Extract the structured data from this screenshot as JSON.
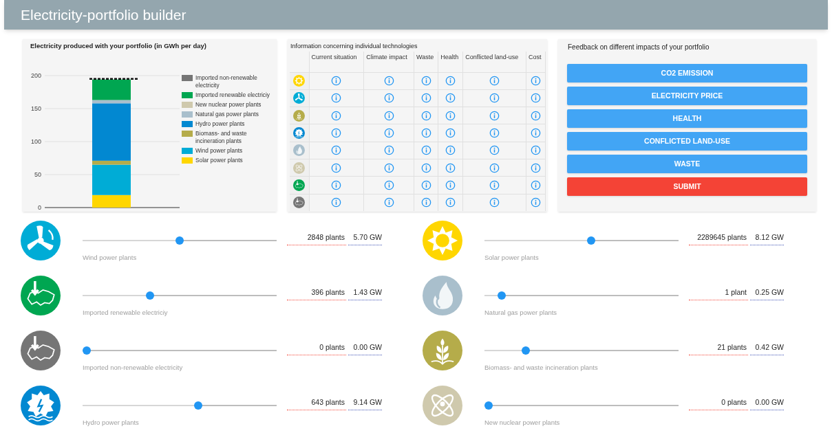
{
  "header": {
    "title": "Electricity-portfolio builder"
  },
  "production_panel": {
    "chart_data": {
      "type": "bar",
      "title": "Electricity produced with your portfolio (in GWh per day)",
      "stacked": true,
      "ylim": [
        0,
        200
      ],
      "yticks": [
        0,
        50,
        100,
        150,
        200
      ],
      "grid": true,
      "ref_lines": [
        {
          "axis": "y",
          "value": 195
        }
      ],
      "series": [
        {
          "name": "Solar power plants",
          "color": "#ffd600",
          "values": [
            19
          ]
        },
        {
          "name": "Wind power plants",
          "color": "#00acd6",
          "values": [
            46
          ]
        },
        {
          "name": "Biomass- and waste incineration plants",
          "color": "#b5ac4a",
          "values": [
            6
          ]
        },
        {
          "name": "Hydro power plants",
          "color": "#0288d1",
          "values": [
            87
          ]
        },
        {
          "name": "Natural gas power plants",
          "color": "#a9bfcc",
          "values": [
            5
          ]
        },
        {
          "name": "New nuclear power plants",
          "color": "#cfc9ad",
          "values": [
            0
          ]
        },
        {
          "name": "Imported renewable electriciy",
          "color": "#00a651",
          "values": [
            31
          ]
        },
        {
          "name": "Imported non-renewable electricity",
          "color": "#757575",
          "values": [
            0
          ]
        }
      ]
    }
  },
  "info_panel": {
    "title": "Information concerning individual technologies",
    "columns": [
      "Current situation",
      "Climate impact",
      "Waste",
      "Health",
      "Conflicted land-use",
      "Cost"
    ],
    "rows": [
      {
        "kind": "solar",
        "color": "#ffd600"
      },
      {
        "kind": "wind",
        "color": "#00acd6"
      },
      {
        "kind": "biomass",
        "color": "#b5ac4a"
      },
      {
        "kind": "hydro",
        "color": "#0288d1"
      },
      {
        "kind": "gas",
        "color": "#a9bfcc"
      },
      {
        "kind": "nuclear",
        "color": "#cfc9ad"
      },
      {
        "kind": "import",
        "color": "#00a651"
      },
      {
        "kind": "import",
        "color": "#757575"
      }
    ]
  },
  "feedback_panel": {
    "title": "Feedback on different impacts of your portfolio",
    "buttons": [
      {
        "label": "CO2 EMISSION",
        "kind": "info"
      },
      {
        "label": "ELECTRICITY PRICE",
        "kind": "info"
      },
      {
        "label": "HEALTH",
        "kind": "info"
      },
      {
        "label": "CONFLICTED LAND-USE",
        "kind": "info"
      },
      {
        "label": "WASTE",
        "kind": "info"
      },
      {
        "label": "SUBMIT",
        "kind": "submit"
      }
    ]
  },
  "sliders": [
    {
      "kind": "wind",
      "color": "#00acd6",
      "label": "Wind power plants",
      "level": 0.5,
      "plants": "2848 plants",
      "power": "5.70 GW"
    },
    {
      "kind": "solar",
      "color": "#ffd600",
      "label": "Solar power plants",
      "level": 0.55,
      "plants": "2289645 plants",
      "power": "8.12 GW"
    },
    {
      "kind": "import",
      "color": "#00a651",
      "label": "Imported renewable electriciy",
      "level": 0.34,
      "plants": "396 plants",
      "power": "1.43 GW"
    },
    {
      "kind": "gas",
      "color": "#a9bfcc",
      "label": "Natural gas power plants",
      "level": 0.07,
      "plants": "1 plant",
      "power": "0.25 GW"
    },
    {
      "kind": "import",
      "color": "#757575",
      "label": "Imported non-renewable electricity",
      "level": 0,
      "plants": "0 plants",
      "power": "0.00 GW"
    },
    {
      "kind": "biomass",
      "color": "#b5ac4a",
      "label": "Biomass- and waste incineration plants",
      "level": 0.2,
      "plants": "21 plants",
      "power": "0.42 GW"
    },
    {
      "kind": "hydro",
      "color": "#0288d1",
      "label": "Hydro power plants",
      "level": 0.6,
      "plants": "643 plants",
      "power": "9.14 GW"
    },
    {
      "kind": "nuclear",
      "color": "#cfc9ad",
      "label": "New nuclear power plants",
      "level": 0,
      "plants": "0 plants",
      "power": "0.00 GW"
    }
  ]
}
